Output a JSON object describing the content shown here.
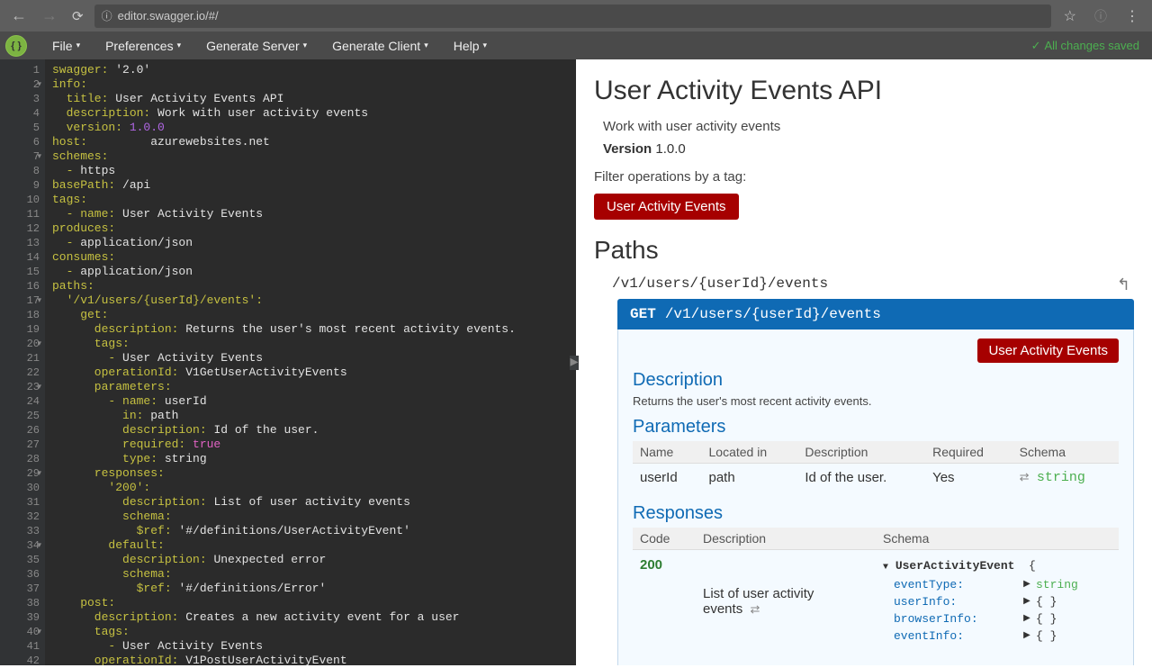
{
  "browser": {
    "url": "editor.swagger.io/#/",
    "url_prefix_icon": "ⓘ"
  },
  "menu": {
    "items": [
      "File",
      "Preferences",
      "Generate Server",
      "Generate Client",
      "Help"
    ],
    "save_status": "All changes saved"
  },
  "editor": {
    "lines": [
      [
        "swagger: ",
        "'2.0'",
        ""
      ],
      [
        "info:",
        "",
        ""
      ],
      [
        "  title: ",
        "User Activity Events API",
        ""
      ],
      [
        "  description: ",
        "Work with user activity events",
        ""
      ],
      [
        "  version: ",
        "",
        "1.0.0"
      ],
      [
        "host: ",
        "        azurewebsites.net",
        ""
      ],
      [
        "schemes:",
        "",
        ""
      ],
      [
        "  - ",
        "https",
        ""
      ],
      [
        "basePath: ",
        "/api",
        ""
      ],
      [
        "tags:",
        "",
        ""
      ],
      [
        "  - name: ",
        "User Activity Events",
        ""
      ],
      [
        "produces:",
        "",
        ""
      ],
      [
        "  - ",
        "application/json",
        ""
      ],
      [
        "consumes:",
        "",
        ""
      ],
      [
        "  - ",
        "application/json",
        ""
      ],
      [
        "paths:",
        "",
        ""
      ],
      [
        "  '/v1/users/{userId}/events':",
        "",
        ""
      ],
      [
        "    get:",
        "",
        ""
      ],
      [
        "      description: ",
        "Returns the user's most recent activity events.",
        ""
      ],
      [
        "      tags:",
        "",
        ""
      ],
      [
        "        - ",
        "User Activity Events",
        ""
      ],
      [
        "      operationId: ",
        "V1GetUserActivityEvents",
        ""
      ],
      [
        "      parameters:",
        "",
        ""
      ],
      [
        "        - name: ",
        "userId",
        ""
      ],
      [
        "          in: ",
        "path",
        ""
      ],
      [
        "          description: ",
        "Id of the user.",
        ""
      ],
      [
        "          required: ",
        "",
        "true"
      ],
      [
        "          type: ",
        "string",
        ""
      ],
      [
        "      responses:",
        "",
        ""
      ],
      [
        "        '200':",
        "",
        ""
      ],
      [
        "          description: ",
        "List of user activity events",
        ""
      ],
      [
        "          schema:",
        "",
        ""
      ],
      [
        "            $ref: ",
        "'#/definitions/UserActivityEvent'",
        ""
      ],
      [
        "        default:",
        "",
        ""
      ],
      [
        "          description: ",
        "Unexpected error",
        ""
      ],
      [
        "          schema:",
        "",
        ""
      ],
      [
        "            $ref: ",
        "'#/definitions/Error'",
        ""
      ],
      [
        "    post:",
        "",
        ""
      ],
      [
        "      description: ",
        "Creates a new activity event for a user",
        ""
      ],
      [
        "      tags:",
        "",
        ""
      ],
      [
        "        - ",
        "User Activity Events",
        ""
      ],
      [
        "      operationId: ",
        "V1PostUserActivityEvent",
        ""
      ]
    ],
    "fold_lines": [
      2,
      7,
      17,
      20,
      23,
      29,
      34,
      40
    ]
  },
  "preview": {
    "title": "User Activity Events API",
    "description": "Work with user activity events",
    "version_label": "Version",
    "version": "1.0.0",
    "filter_label": "Filter operations by a tag:",
    "tag": "User Activity Events",
    "paths_heading": "Paths",
    "path": "/v1/users/{userId}/events",
    "op_method": "GET",
    "op_path": "/v1/users/{userId}/events",
    "op_tag": "User Activity Events",
    "sections": {
      "description_h": "Description",
      "description_text": "Returns the user's most recent activity events.",
      "parameters_h": "Parameters",
      "responses_h": "Responses"
    },
    "param_headers": [
      "Name",
      "Located in",
      "Description",
      "Required",
      "Schema"
    ],
    "param_row": {
      "name": "userId",
      "located": "path",
      "description": "Id of the user.",
      "required": "Yes",
      "schema": "string"
    },
    "resp_headers": [
      "Code",
      "Description",
      "Schema"
    ],
    "resp_row": {
      "code": "200",
      "description": "List of user activity events",
      "schema_name": "UserActivityEvent",
      "schema_fields": [
        {
          "key": "eventType:",
          "val": "string"
        },
        {
          "key": "userInfo:",
          "val": "{ }"
        },
        {
          "key": "browserInfo:",
          "val": "{ }"
        },
        {
          "key": "eventInfo:",
          "val": "{ }"
        }
      ]
    }
  }
}
